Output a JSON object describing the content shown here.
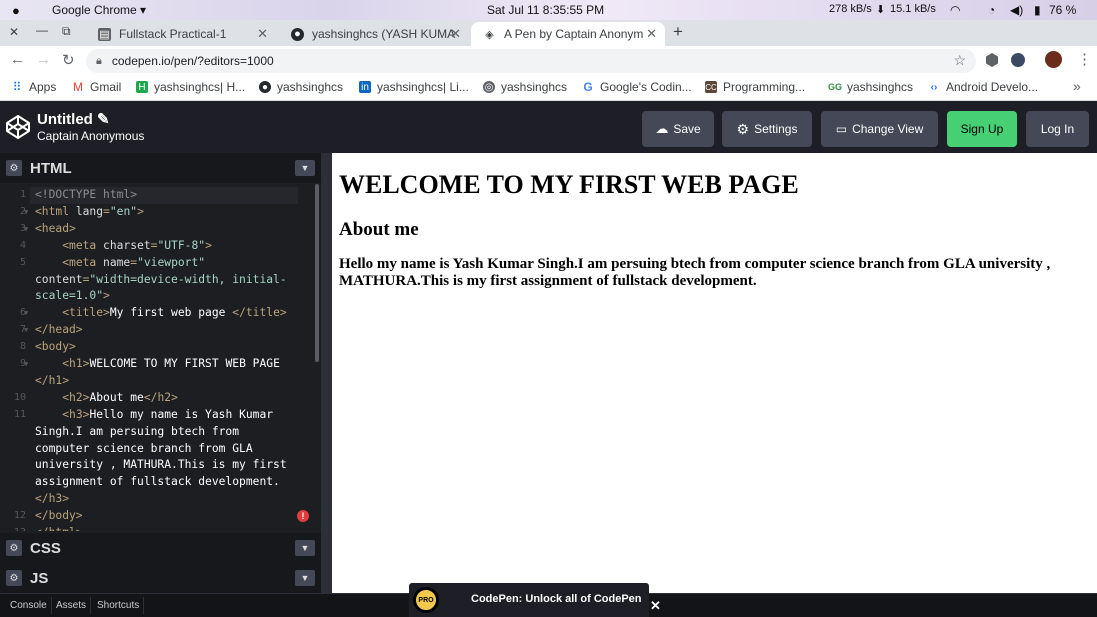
{
  "os": {
    "app_name": "Google Chrome ▾",
    "datetime": "Sat Jul 11   8:35:55 PM",
    "net_up": "278 kB/s",
    "net_down": "15.1 kB/s",
    "battery": "76 %"
  },
  "tabs": [
    {
      "title": "Fullstack Practical-1",
      "icon": "lock-file-icon"
    },
    {
      "title": "yashsinghcs (YASH KUMA",
      "icon": "github-icon"
    },
    {
      "title": "A Pen by Captain Anonym",
      "icon": "codepen-icon"
    }
  ],
  "browser": {
    "url": "codepen.io/pen/?editors=1000"
  },
  "bookmarks": [
    "Apps",
    "Gmail",
    "yashsinghcs| H...",
    "yashsinghcs",
    "yashsinghcs| Li...",
    "yashsinghcs",
    "Google's Codin...",
    "Programming...",
    "yashsinghcs",
    "Android Develo..."
  ],
  "header": {
    "title": "Untitled ✎",
    "author": "Captain Anonymous",
    "buttons": {
      "save": "Save",
      "settings": "Settings",
      "change_view": "Change View",
      "signup": "Sign Up",
      "login": "Log In"
    }
  },
  "editors": {
    "html": "HTML",
    "css": "CSS",
    "js": "JS"
  },
  "code": {
    "line_numbers": [
      "1",
      "2",
      "3",
      "4",
      "5",
      "",
      "",
      "6",
      "7",
      "8",
      "9",
      "",
      "10",
      "11",
      "",
      "",
      "",
      "",
      "",
      "12",
      "13"
    ]
  },
  "preview": {
    "h1": "WELCOME TO MY FIRST WEB PAGE",
    "h2": "About me",
    "h3": "Hello my name is Yash Kumar Singh.I am persuing btech from computer science branch from GLA university , MATHURA.This is my first assignment of fullstack development."
  },
  "bottom": {
    "console": "Console",
    "assets": "Assets",
    "shortcuts": "Shortcuts"
  },
  "promo": {
    "badge": "PRO",
    "text": "CodePen: Unlock all of CodePen",
    "close": "✕"
  }
}
